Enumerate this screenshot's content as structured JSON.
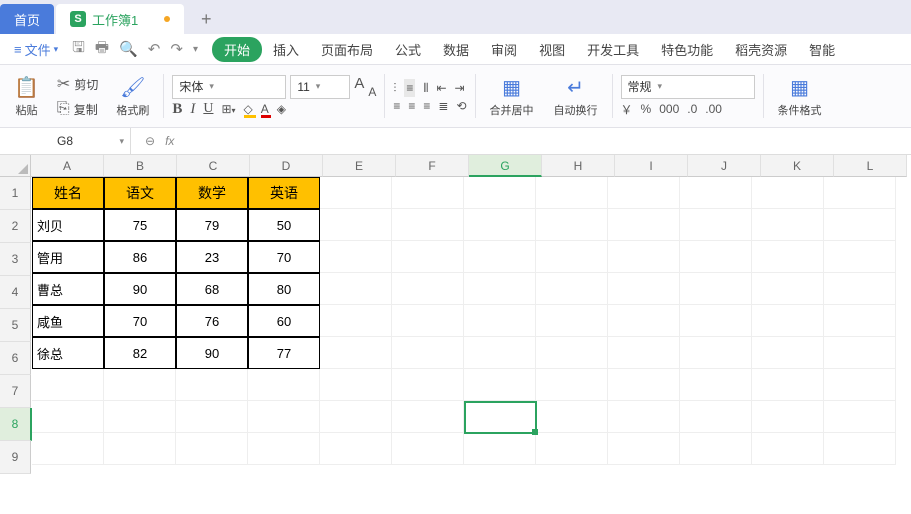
{
  "tabs": {
    "home": "首页",
    "workbook": "工作簿1",
    "plus": "+"
  },
  "file": "文件",
  "menus": [
    "开始",
    "插入",
    "页面布局",
    "公式",
    "数据",
    "审阅",
    "视图",
    "开发工具",
    "特色功能",
    "稻壳资源",
    "智能"
  ],
  "clip": {
    "cut": "剪切",
    "copy": "复制",
    "paste": "粘贴",
    "format": "格式刷"
  },
  "font": {
    "name": "宋体",
    "size": "11"
  },
  "aa": {
    "big": "A",
    "small": "A"
  },
  "merge": "合并居中",
  "wrap": "自动换行",
  "numfmt": "常规",
  "condfmt": "条件格式",
  "namebox": "G8",
  "fx": "fx",
  "cols": [
    "A",
    "B",
    "C",
    "D",
    "E",
    "F",
    "G",
    "H",
    "I",
    "J",
    "K",
    "L"
  ],
  "rows": [
    "1",
    "2",
    "3",
    "4",
    "5",
    "6",
    "7",
    "8",
    "9"
  ],
  "headers": [
    "姓名",
    "语文",
    "数学",
    "英语"
  ],
  "data": [
    [
      "刘贝",
      "75",
      "79",
      "50"
    ],
    [
      "管用",
      "86",
      "23",
      "70"
    ],
    [
      "曹总",
      "90",
      "68",
      "80"
    ],
    [
      "咸鱼",
      "70",
      "76",
      "60"
    ],
    [
      "徐总",
      "82",
      "90",
      "77"
    ]
  ],
  "sym": {
    "yen": "￥",
    "pct": "%",
    "comma": "000",
    "dec1": ".0",
    "dec2": ".00"
  }
}
